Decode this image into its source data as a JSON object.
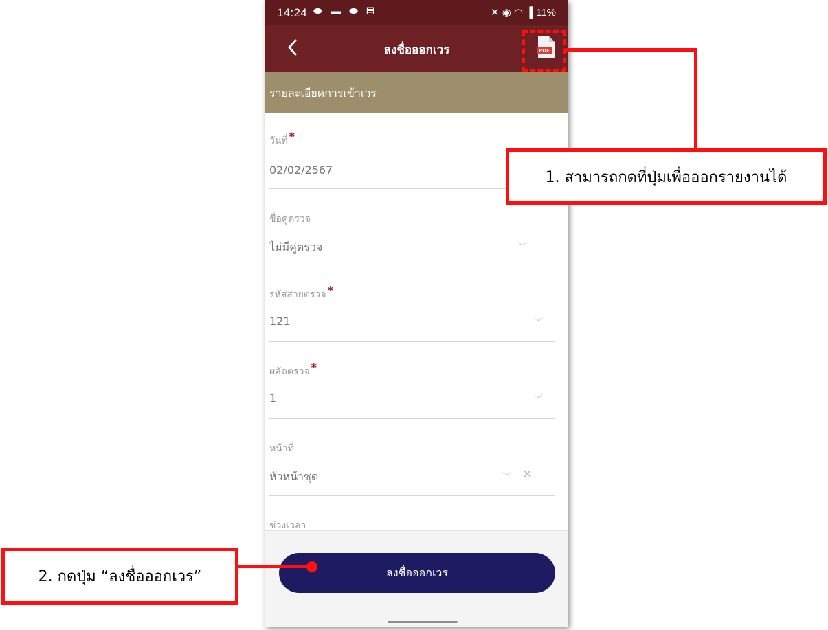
{
  "status_bar": {
    "time": "14:24",
    "notification_icons": "⬬ ▬ ⬬ ▤",
    "system": "✕ ◉ ◠ ▐ 11%"
  },
  "app_bar": {
    "title": "ลงชื่อออกเวร",
    "back_icon": "chevron-left-icon",
    "pdf_icon": "pdf-file-icon",
    "pdf_icon_text": "PDF"
  },
  "section": {
    "title": "รายละเอียดการเข้าเวร"
  },
  "form": {
    "date": {
      "label": "วันที่",
      "required_mark": "*",
      "value": "02/02/2567"
    },
    "partner": {
      "label": "ชื่อคู่ตรวจ",
      "value": "ไม่มีคู่ตรวจ"
    },
    "route_code": {
      "label": "รหัสสายตรวจ",
      "required_mark": "*",
      "value": "121"
    },
    "shift": {
      "label": "ผลัดตรวจ",
      "required_mark": "*",
      "value": "1"
    },
    "duty": {
      "label": "หน้าที่",
      "value": "หัวหน้าชุด",
      "clear_icon": "✕"
    },
    "time_range": {
      "label": "ช่วงเวลา"
    }
  },
  "submit_button": {
    "label": "ลงชื่อออกเวร"
  },
  "annotations": {
    "callout_1": "1. สามารถกดที่ปุ่มเพื่อออกรายงานได้",
    "callout_2": "2. กดปุ่ม “ลงชื่อออกเวร”"
  },
  "colors": {
    "status_bar": "#5e1a1d",
    "app_bar": "#6e2124",
    "section": "#9d8f6c",
    "button": "#1f1b63",
    "annotation": "#ff1010",
    "required": "#a11d2a"
  }
}
